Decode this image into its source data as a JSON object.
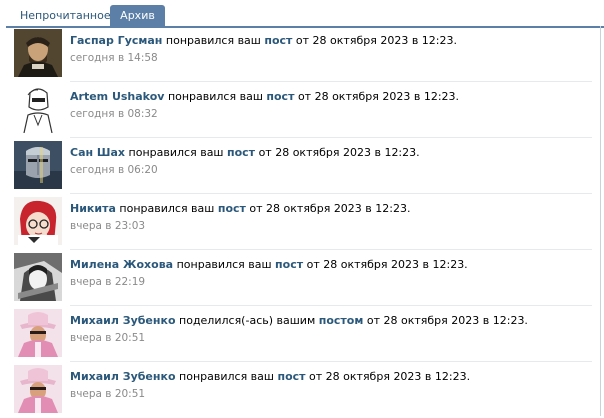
{
  "tabs": [
    {
      "label": "Непрочитанное",
      "active": false
    },
    {
      "label": "Архив",
      "active": true
    }
  ],
  "notifications": [
    {
      "user": "Гаспар Гусман",
      "action": "понравился ваш",
      "object": "пост",
      "suffix": "от 28 октября 2023 в 12:23.",
      "time": "сегодня в 14:58",
      "avatar": "portrait-avatar"
    },
    {
      "user": "Artem Ushakov",
      "action": "понравился ваш",
      "object": "пост",
      "suffix": "от 28 октября 2023 в 12:23.",
      "time": "сегодня в 08:32",
      "avatar": "sketch-avatar"
    },
    {
      "user": "Сан Шах",
      "action": "понравился ваш",
      "object": "пост",
      "suffix": "от 28 октября 2023 в 12:23.",
      "time": "сегодня в 06:20",
      "avatar": "knight-avatar"
    },
    {
      "user": "Никита",
      "action": "понравился ваш",
      "object": "пост",
      "suffix": "от 28 октября 2023 в 12:23.",
      "time": "вчера в 23:03",
      "avatar": "anime-avatar"
    },
    {
      "user": "Милена Жохова",
      "action": "понравился ваш",
      "object": "пост",
      "suffix": "от 28 октября 2023 в 12:23.",
      "time": "вчера в 22:19",
      "avatar": "manga-avatar"
    },
    {
      "user": "Михаил Зубенко",
      "action": "поделился(-ась) вашим",
      "object": "постом",
      "suffix": "от 28 октября 2023 в 12:23.",
      "time": "вчера в 20:51",
      "avatar": "pink-hat-avatar"
    },
    {
      "user": "Михаил Зубенко",
      "action": "понравился ваш",
      "object": "пост",
      "suffix": "от 28 октября 2023 в 12:23.",
      "time": "вчера в 20:51",
      "avatar": "pink-hat-avatar"
    }
  ],
  "colors": {
    "accent": "#5b7fa6",
    "link": "#2b587a",
    "muted": "#8a8a8a"
  }
}
